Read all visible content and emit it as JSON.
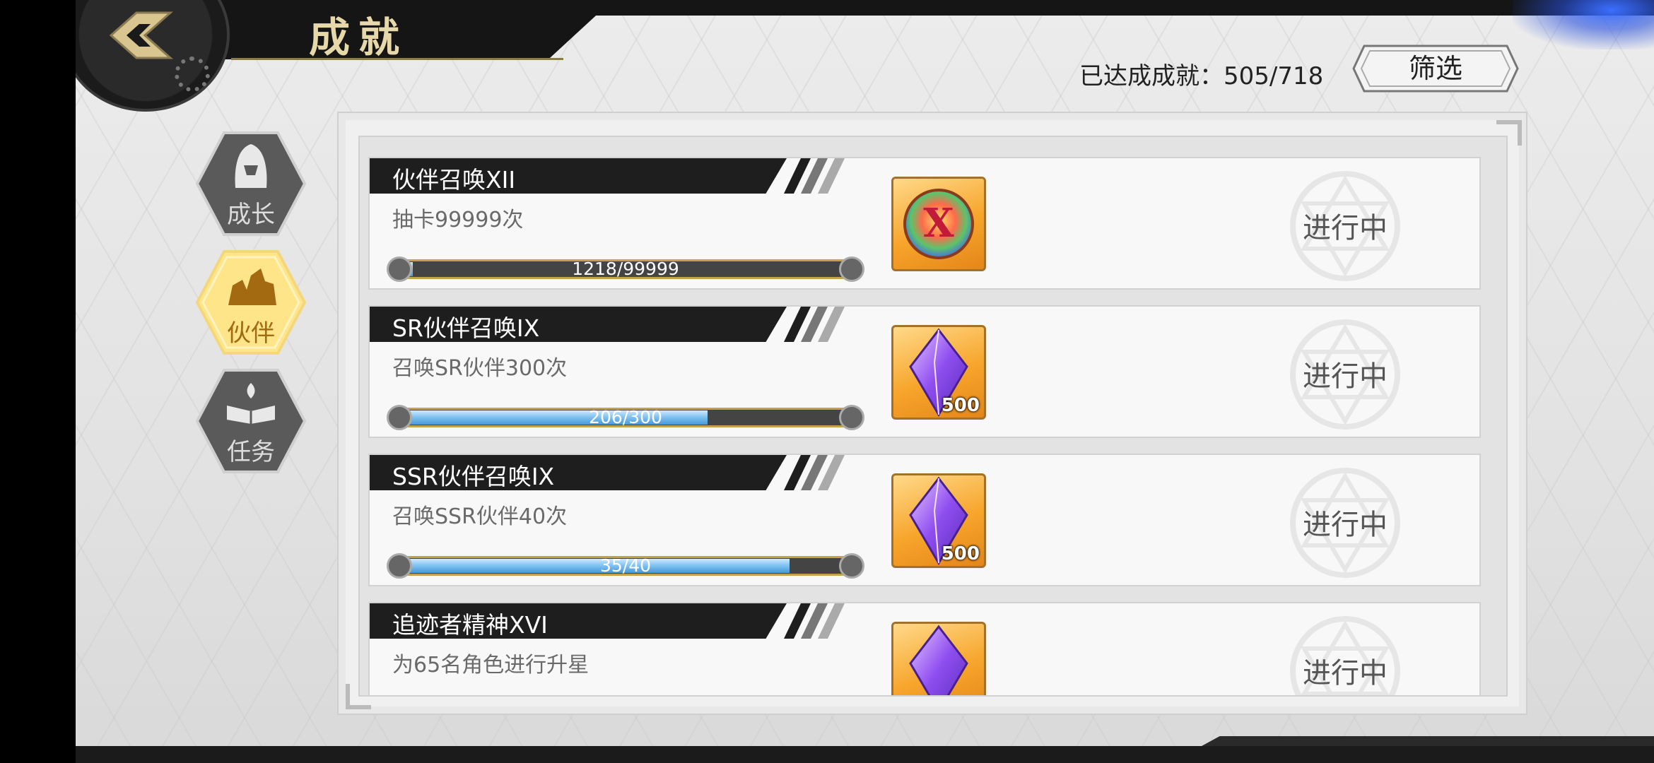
{
  "header": {
    "title": "成就",
    "achievement_label": "已达成成就：",
    "achievement_count": "505/718",
    "filter_label": "筛选"
  },
  "tabs": [
    {
      "label": "成长",
      "active": false,
      "icon": "hooded-figure-icon"
    },
    {
      "label": "伙伴",
      "active": true,
      "icon": "party-members-icon"
    },
    {
      "label": "任务",
      "active": false,
      "icon": "book-flame-icon"
    }
  ],
  "achievements": [
    {
      "title": "伙伴召唤XII",
      "desc": "抽卡99999次",
      "progress_text": "1218/99999",
      "progress": 0.0122,
      "reward_icon": "rainbow-x-medal-icon",
      "reward_qty": "",
      "status": "进行中"
    },
    {
      "title": "SR伙伴召唤IX",
      "desc": "召唤SR伙伴300次",
      "progress_text": "206/300",
      "progress": 0.687,
      "reward_icon": "purple-crystal-icon",
      "reward_qty": "500",
      "status": "进行中"
    },
    {
      "title": "SSR伙伴召唤IX",
      "desc": "召唤SSR伙伴40次",
      "progress_text": "35/40",
      "progress": 0.875,
      "reward_icon": "purple-crystal-icon",
      "reward_qty": "500",
      "status": "进行中"
    },
    {
      "title": "追迹者精神XVI",
      "desc": "为65名角色进行升星",
      "progress_text": "",
      "progress": 0,
      "reward_icon": "purple-crystal-icon",
      "reward_qty": "",
      "status": "进行中"
    }
  ],
  "colors": {
    "accent_gold": "#c5a24a",
    "progress_blue": "#7cc0f0",
    "title_bar": "#1e1e1e"
  }
}
